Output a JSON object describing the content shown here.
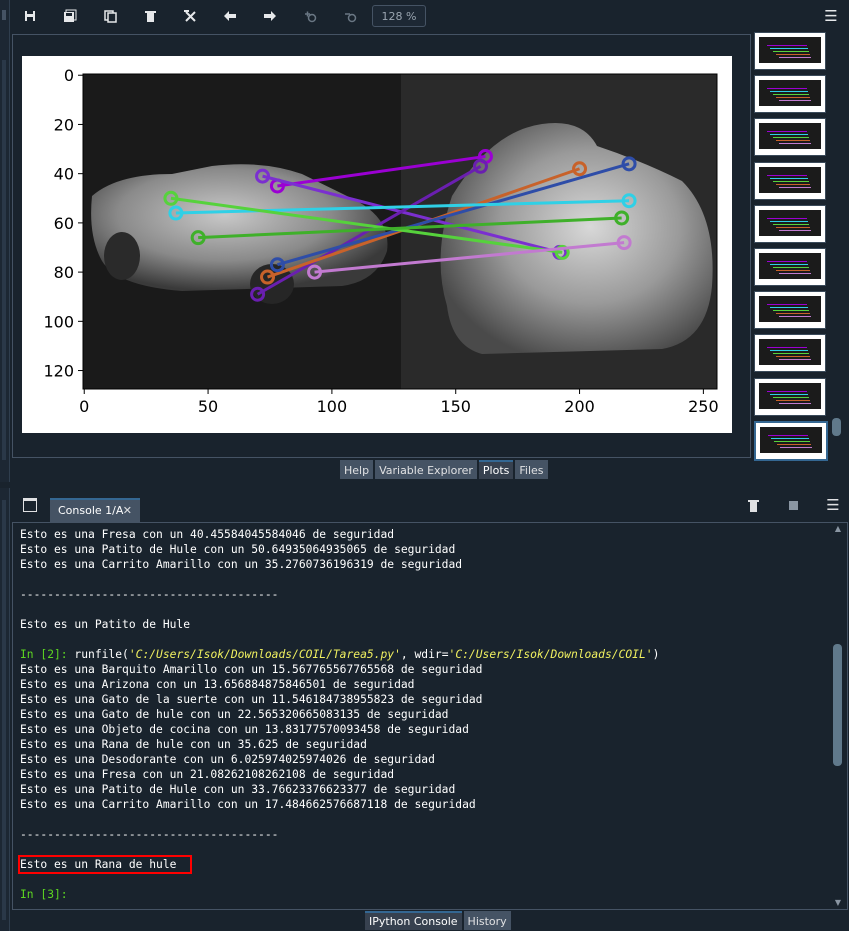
{
  "toolbar": {
    "zoom_level": "128 %",
    "buttons": [
      "save-icon",
      "save-all-icon",
      "copy-icon",
      "delete-icon",
      "delete-all-icon",
      "arrow-left-icon",
      "arrow-right-icon",
      "zoom-in-icon",
      "zoom-out-icon"
    ]
  },
  "plot": {
    "image_description": "rubber toy car and rubber frog grayscale images with keypoint matches",
    "x_ticks": [
      "0",
      "50",
      "100",
      "150",
      "200",
      "250"
    ],
    "y_ticks": [
      "0",
      "20",
      "40",
      "60",
      "80",
      "100",
      "120"
    ]
  },
  "chart_data": {
    "type": "scatter",
    "title": "",
    "xlabel": "",
    "ylabel": "",
    "xlim": [
      -0.5,
      255.5
    ],
    "ylim": [
      127.5,
      -0.5
    ],
    "x_ticks": [
      0,
      50,
      100,
      150,
      200,
      250
    ],
    "y_ticks": [
      0,
      20,
      40,
      60,
      80,
      100,
      120
    ],
    "match_lines": [
      {
        "color": "#9b00d3",
        "x1": 78,
        "y1": 45,
        "x2": 162,
        "y2": 33
      },
      {
        "color": "#7b2fd0",
        "x1": 72,
        "y1": 41,
        "x2": 192,
        "y2": 72
      },
      {
        "color": "#6a1fb0",
        "x1": 70,
        "y1": 89,
        "x2": 160,
        "y2": 37
      },
      {
        "color": "#c8622a",
        "x1": 74,
        "y1": 82,
        "x2": 200,
        "y2": 38
      },
      {
        "color": "#2e4da8",
        "x1": 78,
        "y1": 77,
        "x2": 220,
        "y2": 36
      },
      {
        "color": "#2fd0e6",
        "x1": 37,
        "y1": 56,
        "x2": 220,
        "y2": 51
      },
      {
        "color": "#56d23c",
        "x1": 35,
        "y1": 50,
        "x2": 193,
        "y2": 72
      },
      {
        "color": "#3fb02a",
        "x1": 46,
        "y1": 66,
        "x2": 217,
        "y2": 58
      },
      {
        "color": "#c27ad0",
        "x1": 93,
        "y1": 80,
        "x2": 218,
        "y2": 68
      }
    ]
  },
  "thumbnails": {
    "count": 10,
    "selected_index": 9
  },
  "bottom_tabs_plots": [
    {
      "label": "Help",
      "active": false
    },
    {
      "label": "Variable Explorer",
      "active": false
    },
    {
      "label": "Plots",
      "active": true
    },
    {
      "label": "Files",
      "active": false
    }
  ],
  "console": {
    "tab_label": "Console 1/A",
    "close_glyph": "✕",
    "lines": [
      {
        "text": "Esto es una Fresa con un 40.45584045584046 de seguridad"
      },
      {
        "text": "Esto es una Patito de Hule con un 50.64935064935065 de seguridad"
      },
      {
        "text": "Esto es una Carrito Amarillo con un 35.2760736196319 de seguridad"
      },
      {
        "text": ""
      },
      {
        "text": "--------------------------------------"
      },
      {
        "text": ""
      },
      {
        "text": "Esto es un Patito de Hule"
      },
      {
        "text": ""
      },
      {
        "prompt": "In [2]: ",
        "text": "runfile(",
        "str1": "'C:/Users/Isok/Downloads/COIL/Tarea5.py'",
        "mid": ", wdir=",
        "str2": "'C:/Users/Isok/Downloads/COIL'",
        "end": ")"
      },
      {
        "text": "Esto es una Barquito Amarillo con un 15.567765567765568 de seguridad"
      },
      {
        "text": "Esto es una Arizona con un 13.656884875846501 de seguridad"
      },
      {
        "text": "Esto es una Gato de la suerte con un 11.546184738955823 de seguridad"
      },
      {
        "text": "Esto es una Gato de hule con un 22.565320665083135 de seguridad"
      },
      {
        "text": "Esto es una Objeto de cocina con un 13.83177570093458 de seguridad"
      },
      {
        "text": "Esto es una Rana de hule con un 35.625 de seguridad"
      },
      {
        "text": "Esto es una Desodorante con un 6.025974025974026 de seguridad"
      },
      {
        "text": "Esto es una Fresa con un 21.0826210826210​8 de seguridad"
      },
      {
        "text": "Esto es una Patito de Hule con un 33.76623376623377 de seguridad"
      },
      {
        "text": "Esto es una Carrito Amarillo con un 17.484662576687118 de seguridad"
      },
      {
        "text": ""
      },
      {
        "text": "--------------------------------------"
      },
      {
        "text": ""
      },
      {
        "text": "Esto es un Rana de hule"
      },
      {
        "text": ""
      },
      {
        "prompt": "In [3]: ",
        "text": ""
      }
    ]
  },
  "bottom_tabs_console": [
    {
      "label": "IPython Console",
      "active": true
    },
    {
      "label": "History",
      "active": false
    }
  ]
}
